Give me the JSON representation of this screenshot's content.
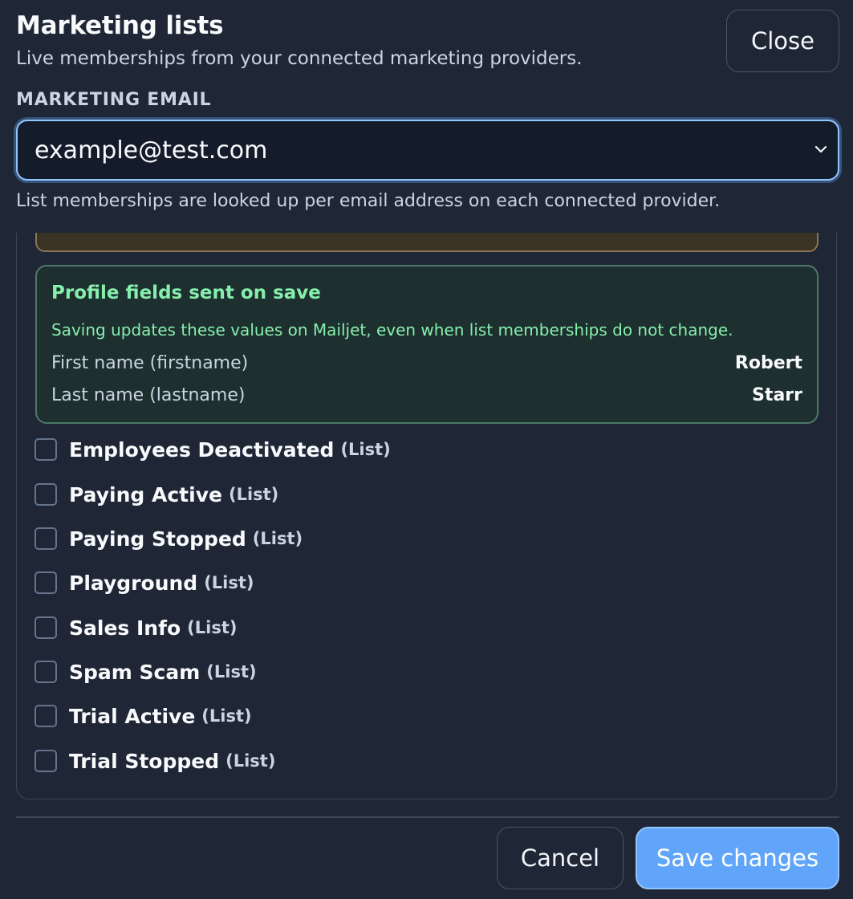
{
  "header": {
    "title": "Marketing lists",
    "subtitle": "Live memberships from your connected marketing providers.",
    "close_label": "Close"
  },
  "email_field": {
    "label": "MARKETING EMAIL",
    "selected_value": "example@test.com",
    "helper": "List memberships are looked up per email address on each connected provider."
  },
  "profile_fields": {
    "title": "Profile fields sent on save",
    "description": "Saving updates these values on Mailjet, even when list memberships do not change.",
    "rows": [
      {
        "label": "First name (firstname)",
        "value": "Robert"
      },
      {
        "label": "Last name (lastname)",
        "value": "Starr"
      }
    ]
  },
  "lists": [
    {
      "name": "Employees Deactivated",
      "kind": "(List)",
      "checked": false
    },
    {
      "name": "Paying Active",
      "kind": "(List)",
      "checked": false
    },
    {
      "name": "Paying Stopped",
      "kind": "(List)",
      "checked": false
    },
    {
      "name": "Playground",
      "kind": "(List)",
      "checked": false
    },
    {
      "name": "Sales Info",
      "kind": "(List)",
      "checked": false
    },
    {
      "name": "Spam Scam",
      "kind": "(List)",
      "checked": false
    },
    {
      "name": "Trial Active",
      "kind": "(List)",
      "checked": false
    },
    {
      "name": "Trial Stopped",
      "kind": "(List)",
      "checked": false
    }
  ],
  "footer": {
    "cancel_label": "Cancel",
    "save_label": "Save changes"
  },
  "colors": {
    "background": "#1f2737",
    "accent": "#60a5fa",
    "success_text": "#86efac",
    "warning_border": "#8a7556"
  }
}
